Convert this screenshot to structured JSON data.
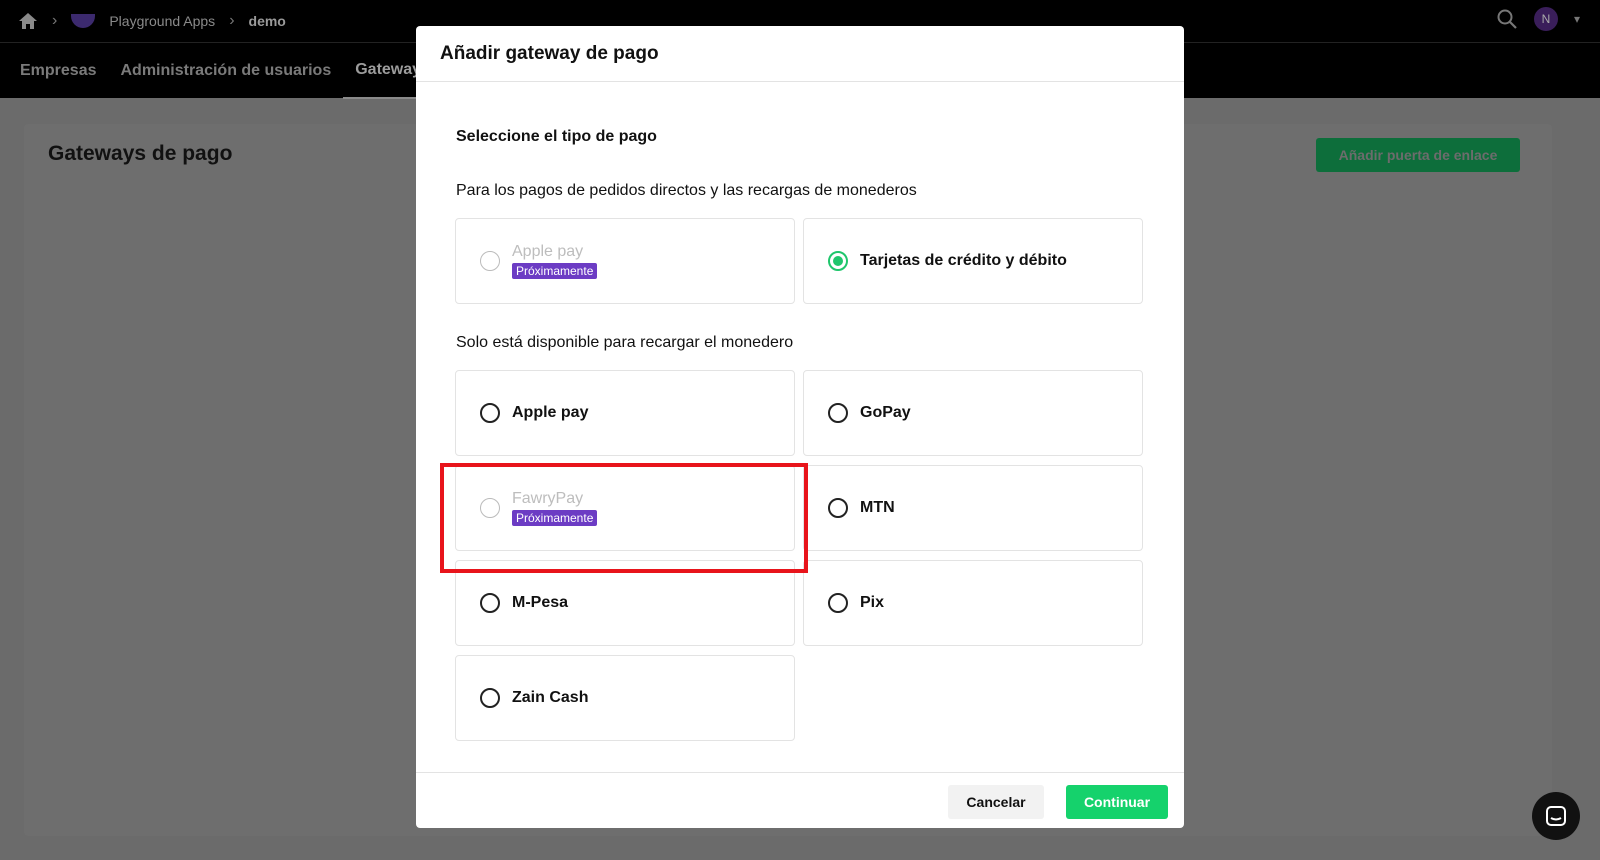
{
  "topbar": {
    "breadcrumb": [
      "Playground Apps",
      "demo"
    ],
    "avatar_initial": "N"
  },
  "nav": {
    "tabs": [
      "Empresas",
      "Administración de usuarios",
      "Gateways"
    ]
  },
  "page": {
    "title": "Gateways de pago",
    "add_button": "Añadir puerta de enlace"
  },
  "modal": {
    "title": "Añadir gateway de pago",
    "section_title": "Seleccione el tipo de pago",
    "group1_label": "Para los pagos de pedidos directos y las recargas de monederos",
    "group1_options": [
      {
        "label": "Apple pay",
        "badge": "Próximamente",
        "state": "disabled"
      },
      {
        "label": "Tarjetas de crédito y débito",
        "state": "selected"
      }
    ],
    "group2_label": "Solo está disponible para recargar el monedero",
    "group2_options": [
      {
        "label": "Apple pay",
        "state": "unselected"
      },
      {
        "label": "GoPay",
        "state": "unselected"
      },
      {
        "label": "FawryPay",
        "badge": "Próximamente",
        "state": "disabled"
      },
      {
        "label": "MTN",
        "state": "unselected"
      },
      {
        "label": "M-Pesa",
        "state": "unselected"
      },
      {
        "label": "Pix",
        "state": "unselected"
      },
      {
        "label": "Zain Cash",
        "state": "unselected"
      }
    ],
    "cancel": "Cancelar",
    "continue": "Continuar"
  },
  "colors": {
    "accent_green": "#15d26c",
    "badge_purple": "#6c3cc4",
    "highlight_red": "#e8141b"
  }
}
